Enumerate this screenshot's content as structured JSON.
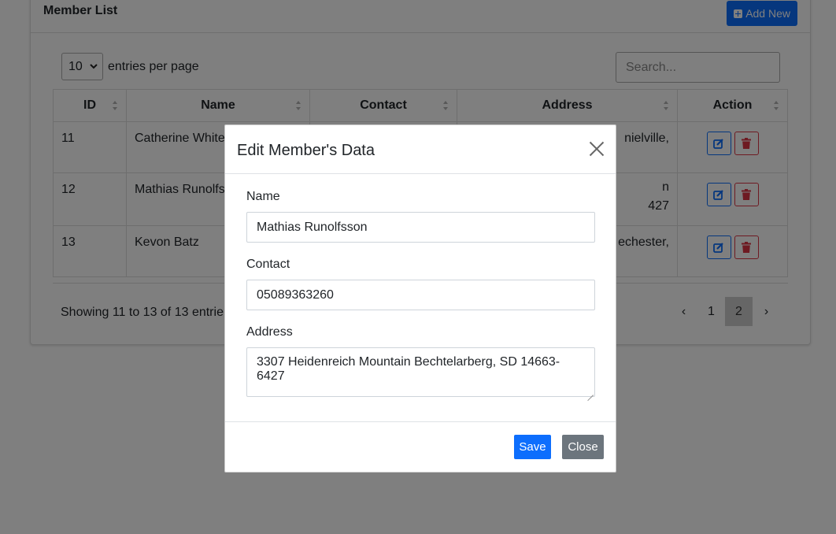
{
  "card": {
    "title": "Member List",
    "add_label": "Add New",
    "per_page_value": "10",
    "per_page_suffix": "entries per page",
    "search_placeholder": "Search...",
    "columns": [
      "ID",
      "Name",
      "Contact",
      "Address",
      "Action"
    ],
    "rows": [
      {
        "id": "11",
        "name": "Catherine White",
        "address_visible": "nielville,"
      },
      {
        "id": "12",
        "name": "Mathias Runolfs",
        "address_visible": "n",
        "address_line2": "427"
      },
      {
        "id": "13",
        "name": "Kevon Batz",
        "address_visible": "echester,"
      }
    ],
    "showing": "Showing 11 to 13 of 13 entrie",
    "pager": {
      "prev": "‹",
      "pages": [
        "1",
        "2"
      ],
      "active": "2",
      "next": "›"
    }
  },
  "modal": {
    "title": "Edit Member's Data",
    "name_label": "Name",
    "name_value": "Mathias Runolfsson",
    "contact_label": "Contact",
    "contact_value": "05089363260",
    "address_label": "Address",
    "address_value": "3307 Heidenreich Mountain Bechtelarberg, SD 14663-6427",
    "save_label": "Save",
    "close_label": "Close"
  },
  "colors": {
    "primary": "#0d6efd",
    "danger": "#dc3545",
    "secondary": "#6c757d"
  }
}
